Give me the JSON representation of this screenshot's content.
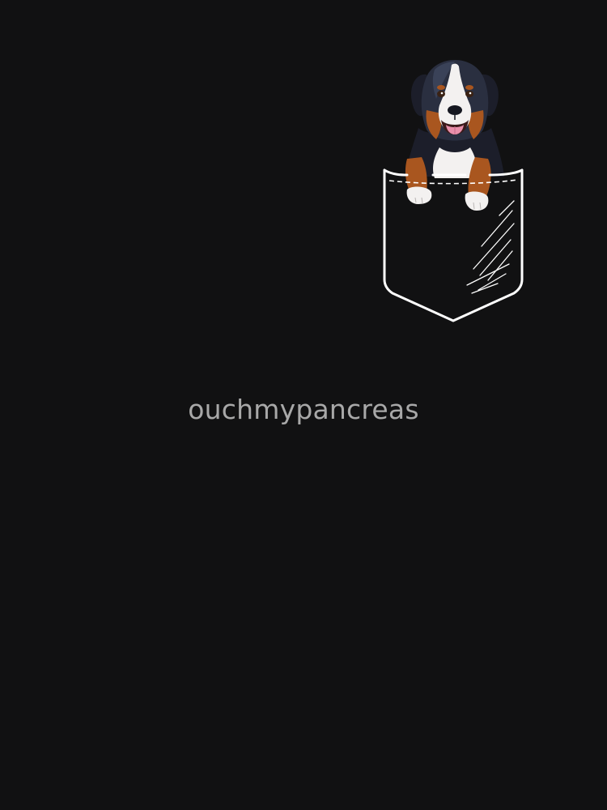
{
  "artwork": {
    "subject": "bernese-mountain-dog-puppy-in-pocket",
    "watermark_text": "ouchmypancreas"
  },
  "colors": {
    "background": "#111112",
    "watermark": "#a8a8a8",
    "pocket_outline": "#ffffff",
    "fur_black": "#1c1e2a",
    "fur_blue_grey": "#3a4258",
    "fur_tan": "#a9561f",
    "fur_white": "#f3f1f0",
    "tongue": "#e98faa"
  }
}
